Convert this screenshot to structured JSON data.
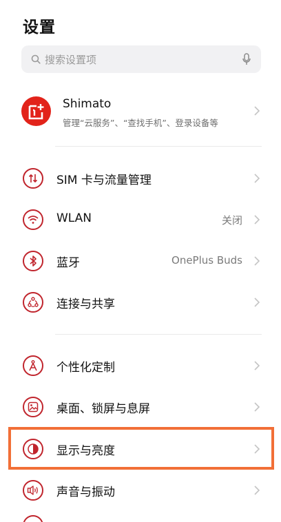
{
  "header": {
    "title": "设置"
  },
  "search": {
    "placeholder": "搜索设置项",
    "icon": "search-icon",
    "trailing_icon": "mic-icon"
  },
  "account": {
    "name": "Shimato",
    "subtitle": "管理“云服务”、“查找手机”、登录设备等",
    "avatar_icon": "oneplus-logo-icon"
  },
  "menu": [
    {
      "label": "SIM 卡与流量管理",
      "value": "",
      "icon": "sim-data-icon"
    },
    {
      "label": "WLAN",
      "value": "关闭",
      "icon": "wifi-icon"
    },
    {
      "label": "蓝牙",
      "value": "OnePlus Buds",
      "icon": "bluetooth-icon"
    },
    {
      "label": "连接与共享",
      "value": "",
      "icon": "connection-share-icon"
    },
    {
      "label": "个性化定制",
      "value": "",
      "icon": "personalize-icon"
    },
    {
      "label": "桌面、锁屏与息屏",
      "value": "",
      "icon": "wallpaper-icon"
    },
    {
      "label": "显示与亮度",
      "value": "",
      "icon": "display-brightness-icon"
    },
    {
      "label": "声音与振动",
      "value": "",
      "icon": "sound-vibration-icon"
    }
  ],
  "colors": {
    "accent": "#c0242c",
    "brand_red": "#e2231a",
    "highlight": "#f26f37"
  }
}
